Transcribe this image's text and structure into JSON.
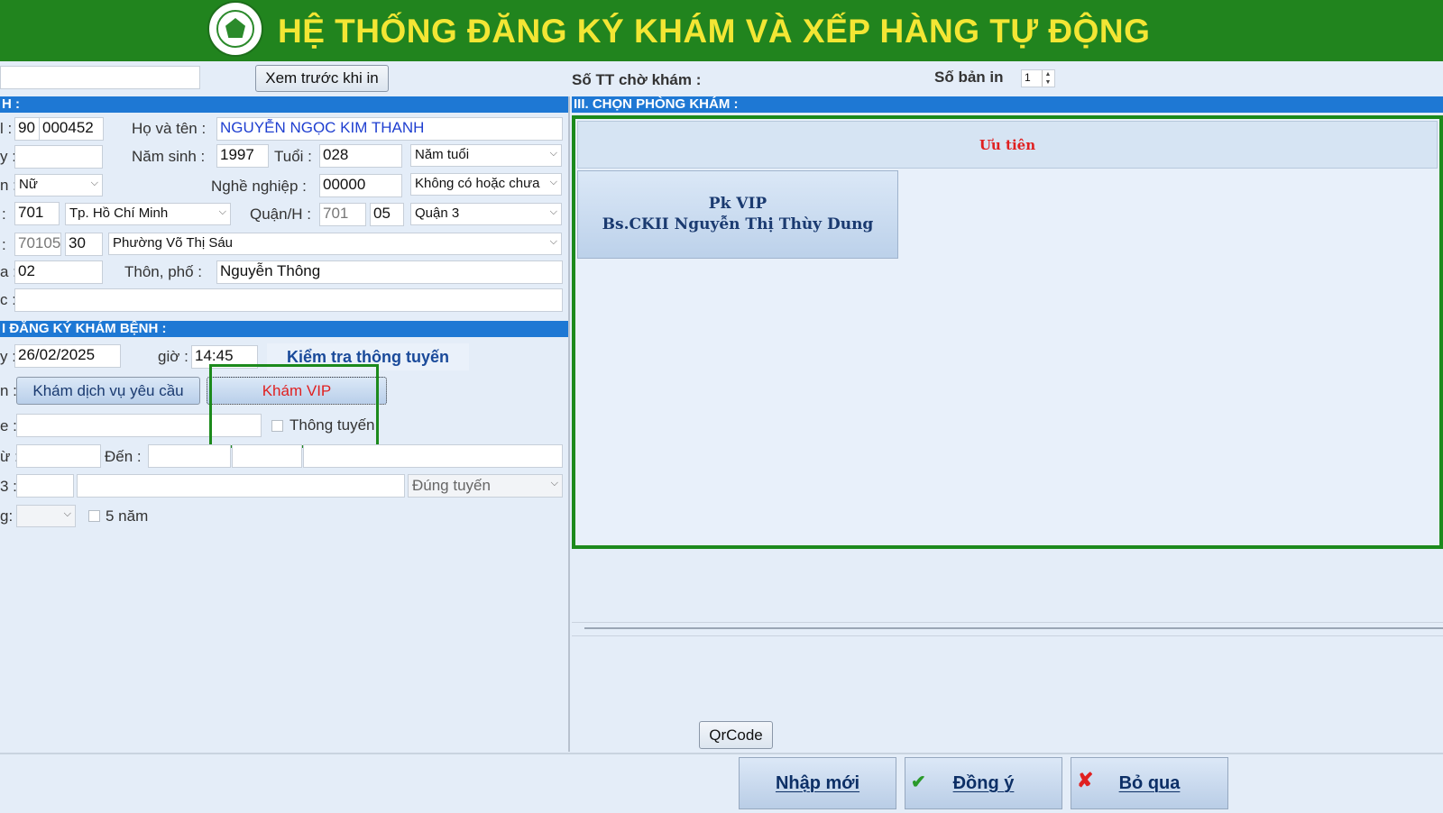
{
  "header": {
    "title": "HỆ THỐNG ĐĂNG KÝ KHÁM VÀ XẾP HÀNG TỰ ĐỘNG"
  },
  "toolbar": {
    "preview_button": "Xem trước khi in",
    "queue_label": "Số TT chờ khám :",
    "copies_label": "Số bản in",
    "copies_value": "1"
  },
  "section1": {
    "title": "H :"
  },
  "patient": {
    "id_label": "l :",
    "id_prefix": "90",
    "id_value": "000452",
    "name_label": "Họ và tên :",
    "name_value": "NGUYỄN NGỌC KIM THANH",
    "row2_label": "y :",
    "row2_value": "",
    "birth_year_label": "Năm sinh :",
    "birth_year": "1997",
    "age_label": "Tuổi :",
    "age_value": "028",
    "age_unit": "Năm tuổi",
    "gender_label": "n :",
    "gender": "Nữ",
    "job_label": "Nghề nghiệp :",
    "job_code": "00000",
    "job_name": "Không có hoặc chưa",
    "province_label": ":",
    "province_code": "701",
    "province_name": "Tp. Hồ Chí Minh",
    "district_label": "Quận/H :",
    "district_prefix": "701",
    "district_code": "05",
    "district_name": "Quận 3",
    "ward_label": ":",
    "ward_prefix": "70105",
    "ward_code": "30",
    "ward_name": "Phường Võ Thị Sáu",
    "village_label": "a :",
    "village_code": "02",
    "street_label": "Thôn, phố :",
    "street_value": "Nguyễn Thông",
    "row7_label": "c :",
    "row7_value": ""
  },
  "section2": {
    "title": "I ĐĂNG KÝ  KHÁM BỆNH :"
  },
  "registration": {
    "date_label": "y :",
    "date_value": "26/02/2025",
    "time_label": "giờ :",
    "time_value": "14:45",
    "check_button": "Kiểm tra thông tuyến",
    "type_label": "n :",
    "service_button": "Khám dịch vụ yêu cầu",
    "vip_button": "Khám VIP",
    "row3_label": "e :",
    "row3_value": "",
    "thong_tuyen_label": "Thông tuyến",
    "from_label": "ừ :",
    "to_label": "Đến :",
    "row5_label": "3 :",
    "route_value": "Đúng tuyến",
    "row6_label": "g:",
    "five_years_label": "5 năm"
  },
  "section3": {
    "title": "III. CHỌN PHÒNG KHÁM :",
    "priority_label": "Ưu tiên",
    "room_name": "Pk VIP",
    "room_doctor": "Bs.CKII Nguyễn Thị Thùy Dung"
  },
  "bottom": {
    "qrcode_button": "QrCode",
    "new_button": "Nhập mới",
    "agree_button": "Đồng ý",
    "skip_button": "Bỏ qua"
  },
  "colors": {
    "header_bg": "#21841e",
    "header_text": "#f3e634",
    "section_bar": "#1e78d4",
    "highlight_border": "#1c8a1c",
    "vip_text": "#e02020",
    "name_text": "#1f3fd0"
  }
}
